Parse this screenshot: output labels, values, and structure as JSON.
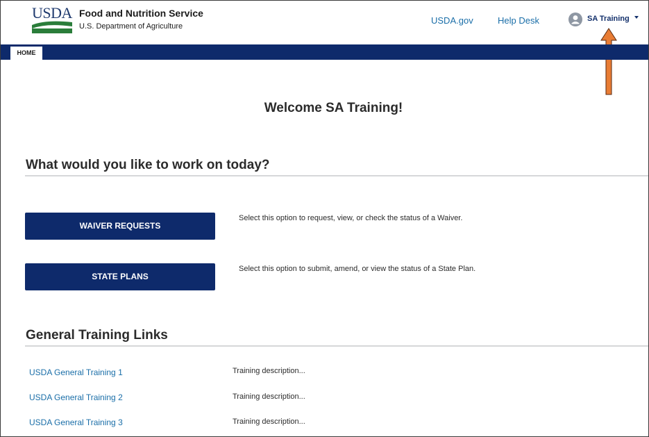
{
  "header": {
    "logo_text": "USDA",
    "agency_name": "Food and Nutrition Service",
    "agency_sub": "U.S. Department of Agriculture",
    "links": [
      "USDA.gov",
      "Help Desk"
    ],
    "user_name": "SA Training"
  },
  "nav": {
    "tabs": [
      "HOME"
    ]
  },
  "main": {
    "welcome": "Welcome SA Training!",
    "prompt": "What would you like to work on today?",
    "actions": [
      {
        "label": "WAIVER REQUESTS",
        "description": "Select this option to request, view, or check the status of a Waiver."
      },
      {
        "label": "STATE PLANS",
        "description": "Select this option to submit, amend, or view the status of a State Plan."
      }
    ],
    "training_title": "General Training Links",
    "training": [
      {
        "label": "USDA General Training 1",
        "description": "Training description..."
      },
      {
        "label": "USDA General Training 2",
        "description": "Training description..."
      },
      {
        "label": "USDA General Training 3",
        "description": "Training description..."
      }
    ]
  },
  "colors": {
    "nav_blue": "#0e2a6b",
    "link_blue": "#1a6ea8",
    "annotation_arrow": "#e87c34"
  }
}
